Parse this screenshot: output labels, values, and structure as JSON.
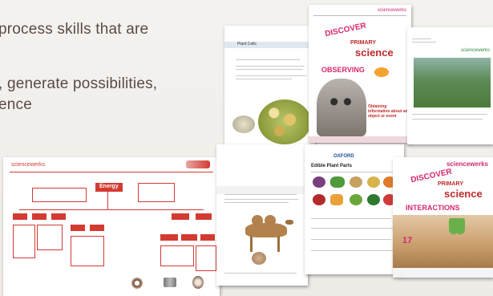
{
  "slide": {
    "text_lines": [
      "process skills that are",
      ", generate possibilities,",
      "ence"
    ]
  },
  "pages": {
    "concept_map": {
      "brand": "sciencewerks",
      "center_label": "Energy"
    },
    "plant_cells": {
      "title": "Plant Cells"
    },
    "observing": {
      "brand": "sciencewerks",
      "logo_word_1": "DISCOVER",
      "logo_word_2": "PRIMARY",
      "logo_word_3": "science",
      "subtitle": "OBSERVING",
      "caption": "Obtaining information about an object or event"
    },
    "photo_page": {
      "brand": "sciencewerks"
    },
    "camel_page": {
      "title": "Camel"
    },
    "food_page": {
      "title": "Edible Plant Parts",
      "logo": "OXFORD"
    },
    "interactions": {
      "brand": "sciencewerks",
      "logo_word_1": "DISCOVER",
      "logo_word_2": "PRIMARY",
      "logo_word_3": "science",
      "subtitle": "INTERACTIONS",
      "number": "17"
    }
  },
  "colors": {
    "accent": "#d33a32",
    "brand_pink": "#d6286f",
    "text": "#5a4a4a"
  }
}
